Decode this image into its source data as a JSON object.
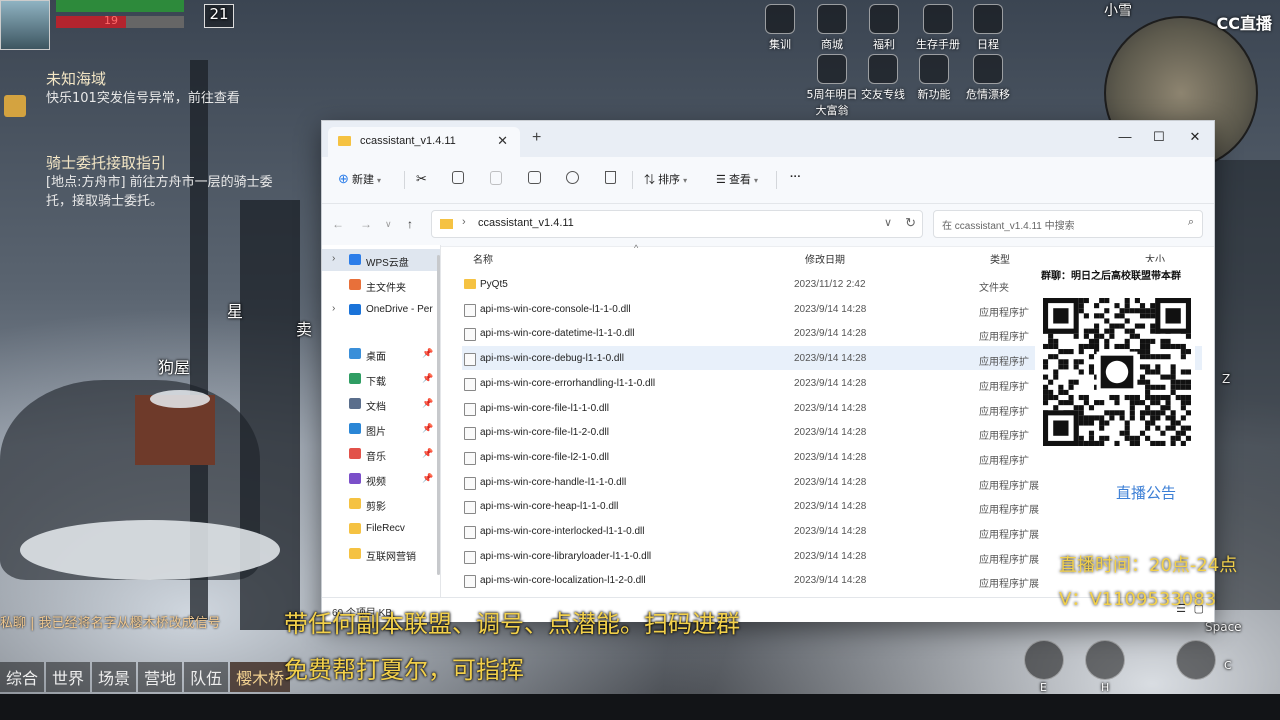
{
  "game": {
    "level": "21",
    "hp_value": "19",
    "quests": [
      {
        "title": "未知海域",
        "desc": "快乐101突发信号异常，前往查看"
      },
      {
        "title": "骑士委托接取指引",
        "desc": "[地点:方舟市] 前往方舟市一层的骑士委托，接取骑士委托。"
      }
    ],
    "menu_icons": [
      {
        "label": "集训"
      },
      {
        "label": "商城"
      },
      {
        "label": "福利"
      },
      {
        "label": "生存手册"
      },
      {
        "label": "日程"
      },
      {
        "label": "5周年明日大富翁"
      },
      {
        "label": "交友专线"
      },
      {
        "label": "新功能"
      },
      {
        "label": "危情漂移"
      }
    ],
    "user_name": "小雪",
    "chat_line": "私聊 | 我已经将名字从樱木桥改成信号",
    "chat_tabs": [
      "综合",
      "世界",
      "场景",
      "营地",
      "队伍",
      "樱木桥"
    ],
    "skill_keys": [
      "E",
      "H",
      "C",
      "Space",
      "Z"
    ],
    "map_labels": [
      "狗屋",
      "星",
      "卖"
    ]
  },
  "stream": {
    "platform_logo": "CC直播",
    "qr_title": "群聊：明日之后高校联盟带本群",
    "notice_label": "直播公告",
    "live_time": "直播时间：20点-24点",
    "contact": "V：V1109533083",
    "promo_line1": "带任何副本联盟、调号、点潜能。扫码进群",
    "promo_line2": "免费帮打夏尔，可指挥"
  },
  "explorer": {
    "tab_title": "ccassistant_v1.4.11",
    "toolbar": {
      "new_label": "新建",
      "sort_label": "排序",
      "view_label": "查看",
      "more_label": "···"
    },
    "address": "ccassistant_v1.4.11",
    "search_placeholder": "在 ccassistant_v1.4.11 中搜索",
    "columns": {
      "name": "名称",
      "date": "修改日期",
      "type": "类型",
      "size": "大小"
    },
    "sidebar": [
      {
        "label": "WPS云盘",
        "icon": "cloud-icon",
        "color": "#2b7de9",
        "expandable": true,
        "selected": true
      },
      {
        "label": "主文件夹",
        "icon": "home-icon",
        "color": "#e8703a",
        "expandable": false
      },
      {
        "label": "OneDrive - Per",
        "icon": "onedrive-icon",
        "color": "#1a73d9",
        "expandable": true
      },
      {
        "label": "桌面",
        "icon": "desktop-icon",
        "color": "#3a8fd9",
        "pinned": true
      },
      {
        "label": "下载",
        "icon": "download-icon",
        "color": "#2f9d63",
        "pinned": true
      },
      {
        "label": "文档",
        "icon": "document-icon",
        "color": "#5a6e8c",
        "pinned": true
      },
      {
        "label": "图片",
        "icon": "picture-icon",
        "color": "#2a86d6",
        "pinned": true
      },
      {
        "label": "音乐",
        "icon": "music-icon",
        "color": "#e2524a",
        "pinned": true
      },
      {
        "label": "视频",
        "icon": "video-icon",
        "color": "#7b4fc9",
        "pinned": true
      },
      {
        "label": "剪影",
        "icon": "folder-icon",
        "color": "#f5c242"
      },
      {
        "label": "FileRecv",
        "icon": "folder-icon",
        "color": "#f5c242"
      },
      {
        "label": "互联网营销",
        "icon": "folder-icon",
        "color": "#f5c242"
      }
    ],
    "files": [
      {
        "name": "PyQt5",
        "date": "2023/11/12 2:42",
        "type": "文件夹",
        "folder": true
      },
      {
        "name": "api-ms-win-core-console-l1-1-0.dll",
        "date": "2023/9/14 14:28",
        "type": "应用程序扩"
      },
      {
        "name": "api-ms-win-core-datetime-l1-1-0.dll",
        "date": "2023/9/14 14:28",
        "type": "应用程序扩"
      },
      {
        "name": "api-ms-win-core-debug-l1-1-0.dll",
        "date": "2023/9/14 14:28",
        "type": "应用程序扩"
      },
      {
        "name": "api-ms-win-core-errorhandling-l1-1-0.dll",
        "date": "2023/9/14 14:28",
        "type": "应用程序扩"
      },
      {
        "name": "api-ms-win-core-file-l1-1-0.dll",
        "date": "2023/9/14 14:28",
        "type": "应用程序扩"
      },
      {
        "name": "api-ms-win-core-file-l1-2-0.dll",
        "date": "2023/9/14 14:28",
        "type": "应用程序扩"
      },
      {
        "name": "api-ms-win-core-file-l2-1-0.dll",
        "date": "2023/9/14 14:28",
        "type": "应用程序扩"
      },
      {
        "name": "api-ms-win-core-handle-l1-1-0.dll",
        "date": "2023/9/14 14:28",
        "type": "应用程序扩展"
      },
      {
        "name": "api-ms-win-core-heap-l1-1-0.dll",
        "date": "2023/9/14 14:28",
        "type": "应用程序扩展"
      },
      {
        "name": "api-ms-win-core-interlocked-l1-1-0.dll",
        "date": "2023/9/14 14:28",
        "type": "应用程序扩展"
      },
      {
        "name": "api-ms-win-core-libraryloader-l1-1-0.dll",
        "date": "2023/9/14 14:28",
        "type": "应用程序扩展"
      },
      {
        "name": "api-ms-win-core-localization-l1-2-0.dll",
        "date": "2023/9/14 14:28",
        "type": "应用程序扩展"
      }
    ],
    "hovered_row_index": 3,
    "status_text": "60 个项目   KB"
  }
}
